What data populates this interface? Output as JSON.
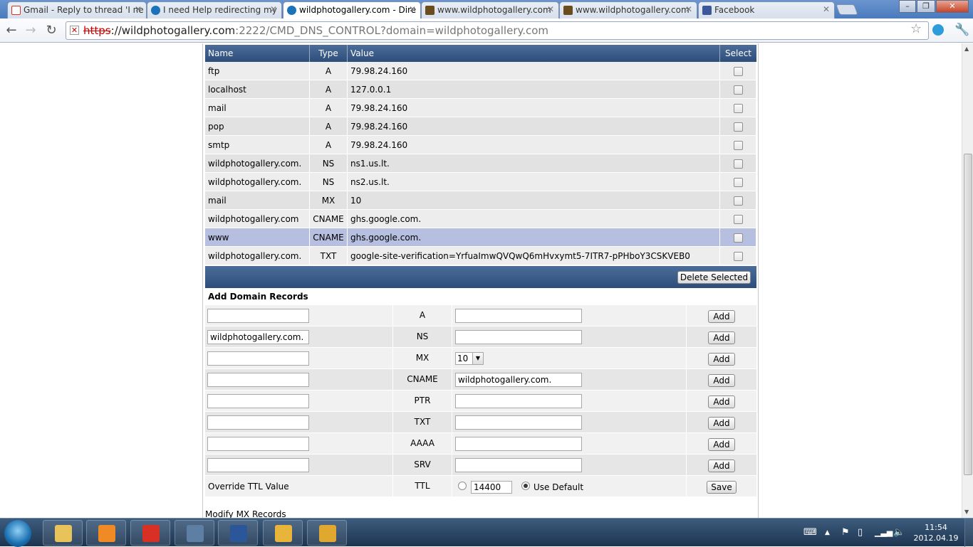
{
  "browser": {
    "tabs": [
      {
        "title": "Gmail - Reply to thread 'I ne",
        "icon": "gmail-icon",
        "color": "#d93025"
      },
      {
        "title": "I need Help redirecting my",
        "icon": "forum-icon",
        "color": "#1a73b8"
      },
      {
        "title": "wildphotogallery.com - Dire",
        "icon": "directadmin-icon",
        "color": "#1a73b8"
      },
      {
        "title": "www.wildphotogallery.com",
        "icon": "page-icon",
        "color": "#6b4c1e"
      },
      {
        "title": "www.wildphotogallery.com",
        "icon": "page-icon",
        "color": "#6b4c1e"
      },
      {
        "title": "Facebook",
        "icon": "facebook-icon",
        "color": "#3b5998"
      }
    ],
    "url_scheme": "https",
    "url_host": "://wildphotogallery.com",
    "url_rest": ":2222/CMD_DNS_CONTROL?domain=wildphotogallery.com"
  },
  "dns_table": {
    "headers": {
      "name": "Name",
      "type": "Type",
      "value": "Value",
      "select": "Select"
    },
    "rows": [
      {
        "name": "ftp",
        "type": "A",
        "value": "79.98.24.160"
      },
      {
        "name": "localhost",
        "type": "A",
        "value": "127.0.0.1"
      },
      {
        "name": "mail",
        "type": "A",
        "value": "79.98.24.160"
      },
      {
        "name": "pop",
        "type": "A",
        "value": "79.98.24.160"
      },
      {
        "name": "smtp",
        "type": "A",
        "value": "79.98.24.160"
      },
      {
        "name": "wildphotogallery.com.",
        "type": "NS",
        "value": "ns1.us.lt."
      },
      {
        "name": "wildphotogallery.com.",
        "type": "NS",
        "value": "ns2.us.lt."
      },
      {
        "name": "mail",
        "type": "MX",
        "value": "10"
      },
      {
        "name": "wildphotogallery.com",
        "type": "CNAME",
        "value": "ghs.google.com."
      },
      {
        "name": "www",
        "type": "CNAME",
        "value": "ghs.google.com."
      },
      {
        "name": "wildphotogallery.com.",
        "type": "TXT",
        "value": "google-site-verification=YrfuaImwQVQwQ6mHvxymt5-7ITR7-pPHboY3CSKVEB0"
      }
    ],
    "delete_label": "Delete Selected"
  },
  "add_records": {
    "title": "Add Domain Records",
    "add_label": "Add",
    "rows": [
      {
        "type": "A",
        "name_value": "",
        "value": ""
      },
      {
        "type": "NS",
        "name_value": "wildphotogallery.com.",
        "value": ""
      },
      {
        "type": "MX",
        "name_value": "",
        "value": "10"
      },
      {
        "type": "CNAME",
        "name_value": "",
        "value": "wildphotogallery.com."
      },
      {
        "type": "PTR",
        "name_value": "",
        "value": ""
      },
      {
        "type": "TXT",
        "name_value": "",
        "value": ""
      },
      {
        "type": "AAAA",
        "name_value": "",
        "value": ""
      },
      {
        "type": "SRV",
        "name_value": "",
        "value": ""
      }
    ],
    "ttl": {
      "label": "Override TTL Value",
      "type": "TTL",
      "value": "14400",
      "default_label": "Use Default",
      "save_label": "Save"
    }
  },
  "modify_mx_label": "Modify MX Records",
  "taskbar": {
    "apps": [
      {
        "icon": "explorer-icon",
        "color": "#e8c35a"
      },
      {
        "icon": "media-player-icon",
        "color": "#f08a24"
      },
      {
        "icon": "chrome-icon",
        "color": "#d93025"
      },
      {
        "icon": "computer-icon",
        "color": "#5d7fa3"
      },
      {
        "icon": "word-icon",
        "color": "#2b579a"
      },
      {
        "icon": "outlook-icon",
        "color": "#e8b53a"
      },
      {
        "icon": "winamp-icon",
        "color": "#e0a82e"
      }
    ],
    "time": "11:54",
    "date": "2012.04.19"
  }
}
